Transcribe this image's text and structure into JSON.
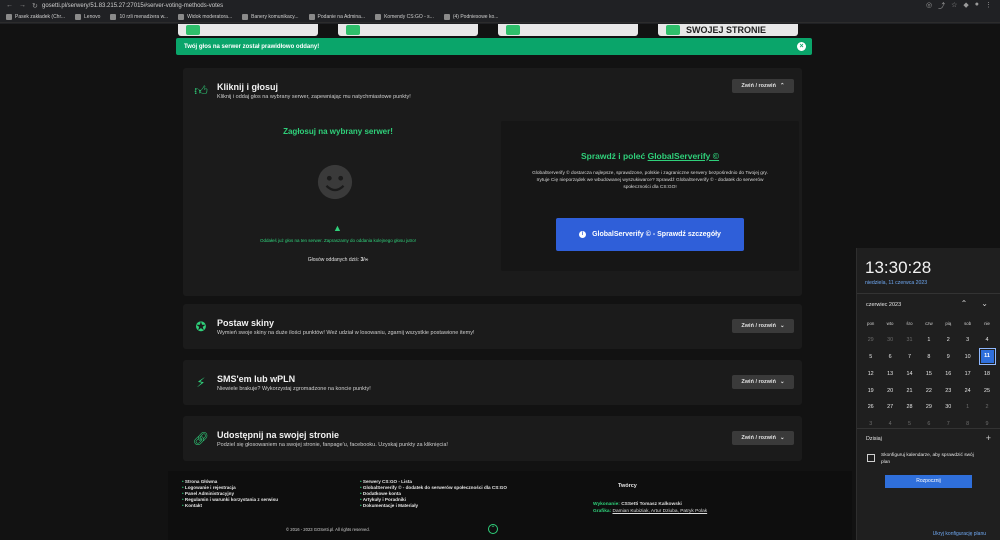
{
  "browser": {
    "url": "gosetti.pl/serwery/51.83.215.27:27015#server-voting-methods-votes",
    "bookmarks": [
      "Pasek zakładek (Chr...",
      "Lenovo",
      "10 rzli menadżera w...",
      "Widok moderatora...",
      "Banery komunikacy...",
      "Podanie na Admina...",
      "Komendy CS:GO - s...",
      "(4) Podniesowe ko..."
    ]
  },
  "top_cards": [
    "",
    "",
    "SWOJEJ STRONIE"
  ],
  "alert": {
    "text": "Twój głos na serwer został prawidłowo oddany!",
    "close": "×"
  },
  "methods": {
    "vote": {
      "title": "Kliknij i głosuj",
      "desc": "Kliknij i oddaj głos na wybrany serwer, zapewniając mu natychmiastowe punkty!",
      "toggle": "Zwiń / rozwiń"
    },
    "skins": {
      "title": "Postaw skiny",
      "desc": "Wymień swoje skiny na duże ilości punktów! Weź udział w losowaniu, zgarnij wszystkie postawione itemy!",
      "toggle": "Zwiń / rozwiń"
    },
    "sms": {
      "title": "SMS'em lub wPLN",
      "desc": "Niewiele brakuje? Wykorzystaj zgromadzone na koncie punkty!",
      "toggle": "Zwiń / rozwiń"
    },
    "share": {
      "title": "Udostępnij na swojej stronie",
      "desc": "Podziel się głosowaniem na swojej stronie, fanpage'u, facebooku. Uzyskaj punkty za kliknięcia!",
      "toggle": "Zwiń / rozwiń"
    }
  },
  "vote_panel": {
    "title": "Zagłosuj na wybrany serwer!",
    "message": "Oddałeś już głos na ten serwer. Zapraszamy do oddania kolejnego głosu jutro!",
    "count_label": "Głosów oddanych dziś:",
    "count_value": "3/∞"
  },
  "global_serverify": {
    "title": "Sprawdź i poleć",
    "title_link": "GlobalServerify ©",
    "desc": "GlobalServerify © dostarcza najlepsze, sprawdzone, polskie i zagraniczne serwery bezpośrednio do Twojej gry. Irytuje Cię nieporządek we wbudowanej wyszukiwarce? Sprawdź GlobalServerify © - dodatek do serwerów społeczności dla CS:GO!",
    "button": "GlobalServerify © - Sprawdź szczegóły"
  },
  "footer": {
    "col1": [
      "Strona Główna",
      "Logowanie i rejestracja",
      "Panel Administracyjny",
      "Regulamin i warunki korzystania z serwisu",
      "Kontakt"
    ],
    "col2": [
      "Serwery CS:GO - Lista",
      "GlobalServerify © - dodatek do serwerów społeczności dla CS:GO",
      "Dodatkowe konta",
      "Artykuły i Poradniki",
      "Dokumentacje i Materiały"
    ],
    "creators_title": "Twórcy",
    "wykonanie_label": "Wykonanie:",
    "wykonanie": "CSSetti Tomasz Kalkowski",
    "grafika_label": "Grafika:",
    "grafika": "Damian Kubiziak, Artur Dziuba, Patryk Polak",
    "copyright": "© 2016 - 2023 GOSetti.pl. All rights reserved."
  },
  "clock": {
    "time": "13:30:28",
    "date": "niedziela, 11 czerwca 2023",
    "month": "czerwiec 2023",
    "weekdays": [
      "pon",
      "wto",
      "śro",
      "czw",
      "pią",
      "sob",
      "nie"
    ],
    "weeks": [
      [
        "29",
        "30",
        "31",
        "1",
        "2",
        "3",
        "4"
      ],
      [
        "5",
        "6",
        "7",
        "8",
        "9",
        "10",
        "11"
      ],
      [
        "12",
        "13",
        "14",
        "15",
        "16",
        "17",
        "18"
      ],
      [
        "19",
        "20",
        "21",
        "22",
        "23",
        "24",
        "25"
      ],
      [
        "26",
        "27",
        "28",
        "29",
        "30",
        "1",
        "2"
      ],
      [
        "3",
        "4",
        "5",
        "6",
        "7",
        "8",
        "9"
      ]
    ],
    "today_label": "Dzisiaj",
    "config_text": "Skonfiguruj kalendarze, aby sprawdzić swój plan",
    "start_button": "Rozpocznij",
    "hide_link": "Ukryj konfigurację planu"
  }
}
